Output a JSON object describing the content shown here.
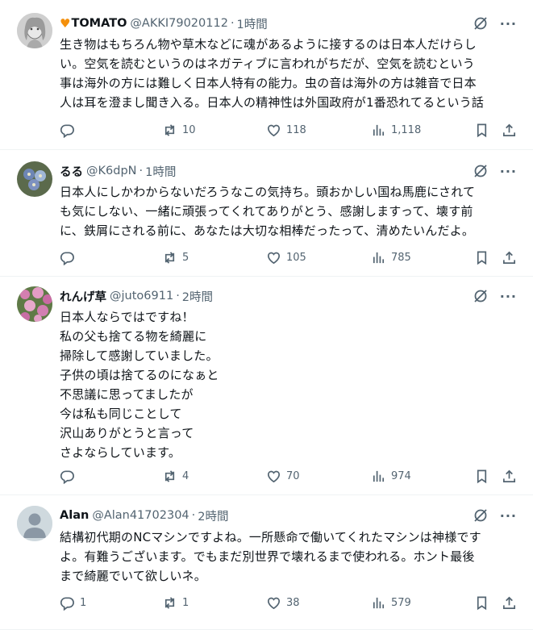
{
  "tweets": [
    {
      "name": "TOMATO",
      "name_prefix_icon": "orange-heart-icon",
      "handle": "@AKKI79020112",
      "time": "1時間",
      "text": "生き物はもちろん物や草木などに魂があるように接するのは日本人だけらし\nい。空気を読むというのはネガティブに言われがちだが、空気を読むという\n事は海外の方には難しく日本人特有の能力。虫の音は海外の方は雑音で日本\n人は耳を澄まし聞き入る。日本人の精神性は外国政府が1番恐れてるという話",
      "replies": "",
      "retweets": "10",
      "likes": "118",
      "views": "1,118"
    },
    {
      "name": "るる",
      "handle": "@K6dpN",
      "time": "1時間",
      "text": "日本人にしかわからないだろうなこの気持ち。頭おかしい国ね馬鹿にされて\nも気にしない、一緒に頑張ってくれてありがとう、感謝しますって、壊す前\nに、鉄屑にされる前に、あなたは大切な相棒だったって、清めたいんだよ。",
      "replies": "",
      "retweets": "5",
      "likes": "105",
      "views": "785"
    },
    {
      "name": "れんげ草",
      "handle": "@juto6911",
      "time": "2時間",
      "text": "日本人ならではですね！\n私の父も捨てる物を綺麗に\n掃除して感謝していました。\n子供の頃は捨てるのになぁと\n不思議に思ってましたが\n今は私も同じことして\n沢山ありがとうと言って\nさよならしています。",
      "replies": "",
      "retweets": "4",
      "likes": "70",
      "views": "974"
    },
    {
      "name": "Alan",
      "handle": "@Alan41702304",
      "time": "2時間",
      "text": "結構初代期のNCマシンですよね。一所懸命で働いてくれたマシンは神様です\nよ。有難うございます。でもまだ別世界で壊れるまで使われる。ホント最後\nまで綺麗でいて欲しいネ。",
      "replies": "1",
      "retweets": "1",
      "likes": "38",
      "views": "579"
    }
  ],
  "colors": {
    "text": "#0f1419",
    "secondary": "#536471",
    "border": "#eff3f4",
    "heart": "#f4900c"
  }
}
